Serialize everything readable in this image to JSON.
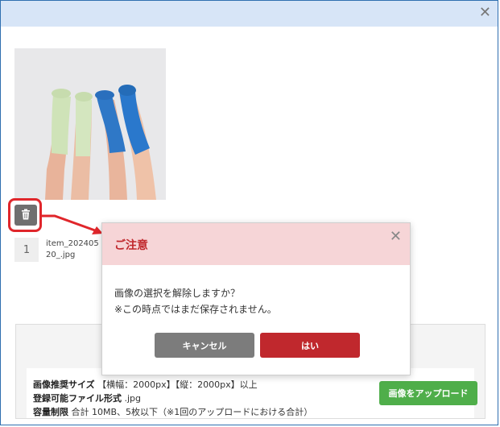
{
  "window": {
    "close_glyph": "✕"
  },
  "item": {
    "index": "1",
    "filename": "item_20240520_.jpg"
  },
  "specs": [
    {
      "label": "画像推奨サイズ",
      "value": " 【横幅：2000px】【縦：2000px】以上"
    },
    {
      "label": "登録可能ファイル形式",
      "value": " .jpg"
    },
    {
      "label": "容量制限",
      "value": " 合計 10MB、5枚以下（※1回のアップロードにおける合計）"
    }
  ],
  "upload_button": "画像をアップロード",
  "modal": {
    "title": "ご注意",
    "close_glyph": "✕",
    "line1": "画像の選択を解除しますか？",
    "line2": "※この時点ではまだ保存されません。",
    "cancel_label": "キャンセル",
    "confirm_label": "はい"
  },
  "colors": {
    "highlight": "#e0262b",
    "accent_red": "#c0282d",
    "upload_green": "#4fae4a",
    "header_blue": "#d7e5f7"
  },
  "icons": {
    "trash": "trash-icon",
    "close": "close-icon"
  }
}
